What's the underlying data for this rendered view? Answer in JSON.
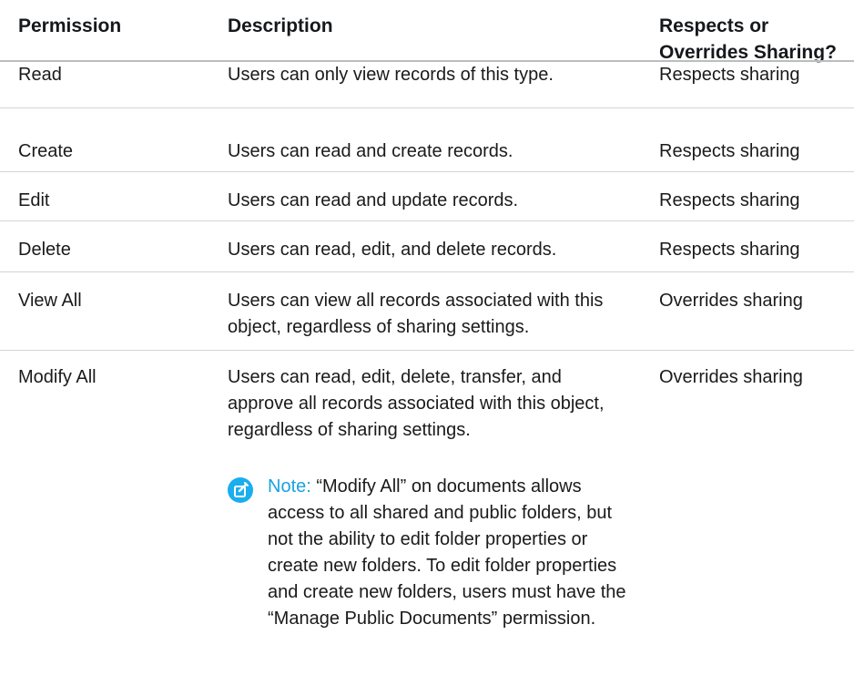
{
  "header": {
    "permission": "Permission",
    "description": "Description",
    "sharing": "Respects or\nOverrides Sharing?"
  },
  "rows": [
    {
      "permission": "Read",
      "description": "Users can only view records of this type.",
      "sharing": "Respects sharing"
    },
    {
      "permission": "Create",
      "description": "Users can read and create records.",
      "sharing": "Respects sharing"
    },
    {
      "permission": "Edit",
      "description": "Users can read and update records.",
      "sharing": "Respects sharing"
    },
    {
      "permission": "Delete",
      "description": "Users can read, edit, and delete records.",
      "sharing": "Respects sharing"
    },
    {
      "permission": "View All",
      "description": "Users can view all records associated with this\nobject, regardless of sharing settings.",
      "sharing": "Overrides sharing"
    },
    {
      "permission": "Modify All",
      "description": "Users can read, edit, delete, transfer, and\napprove all records associated with this object,\nregardless of sharing settings.",
      "sharing": "Overrides sharing"
    }
  ],
  "note": {
    "label": "Note:",
    "text": "“Modify All” on documents allows access to all shared and public folders, but not the ability to edit folder properties or create new folders. To edit folder properties and create new folders, users must have the “Manage Public Documents” permission.",
    "icon": "edit-note-icon",
    "icon_color": "#1aaeef"
  }
}
